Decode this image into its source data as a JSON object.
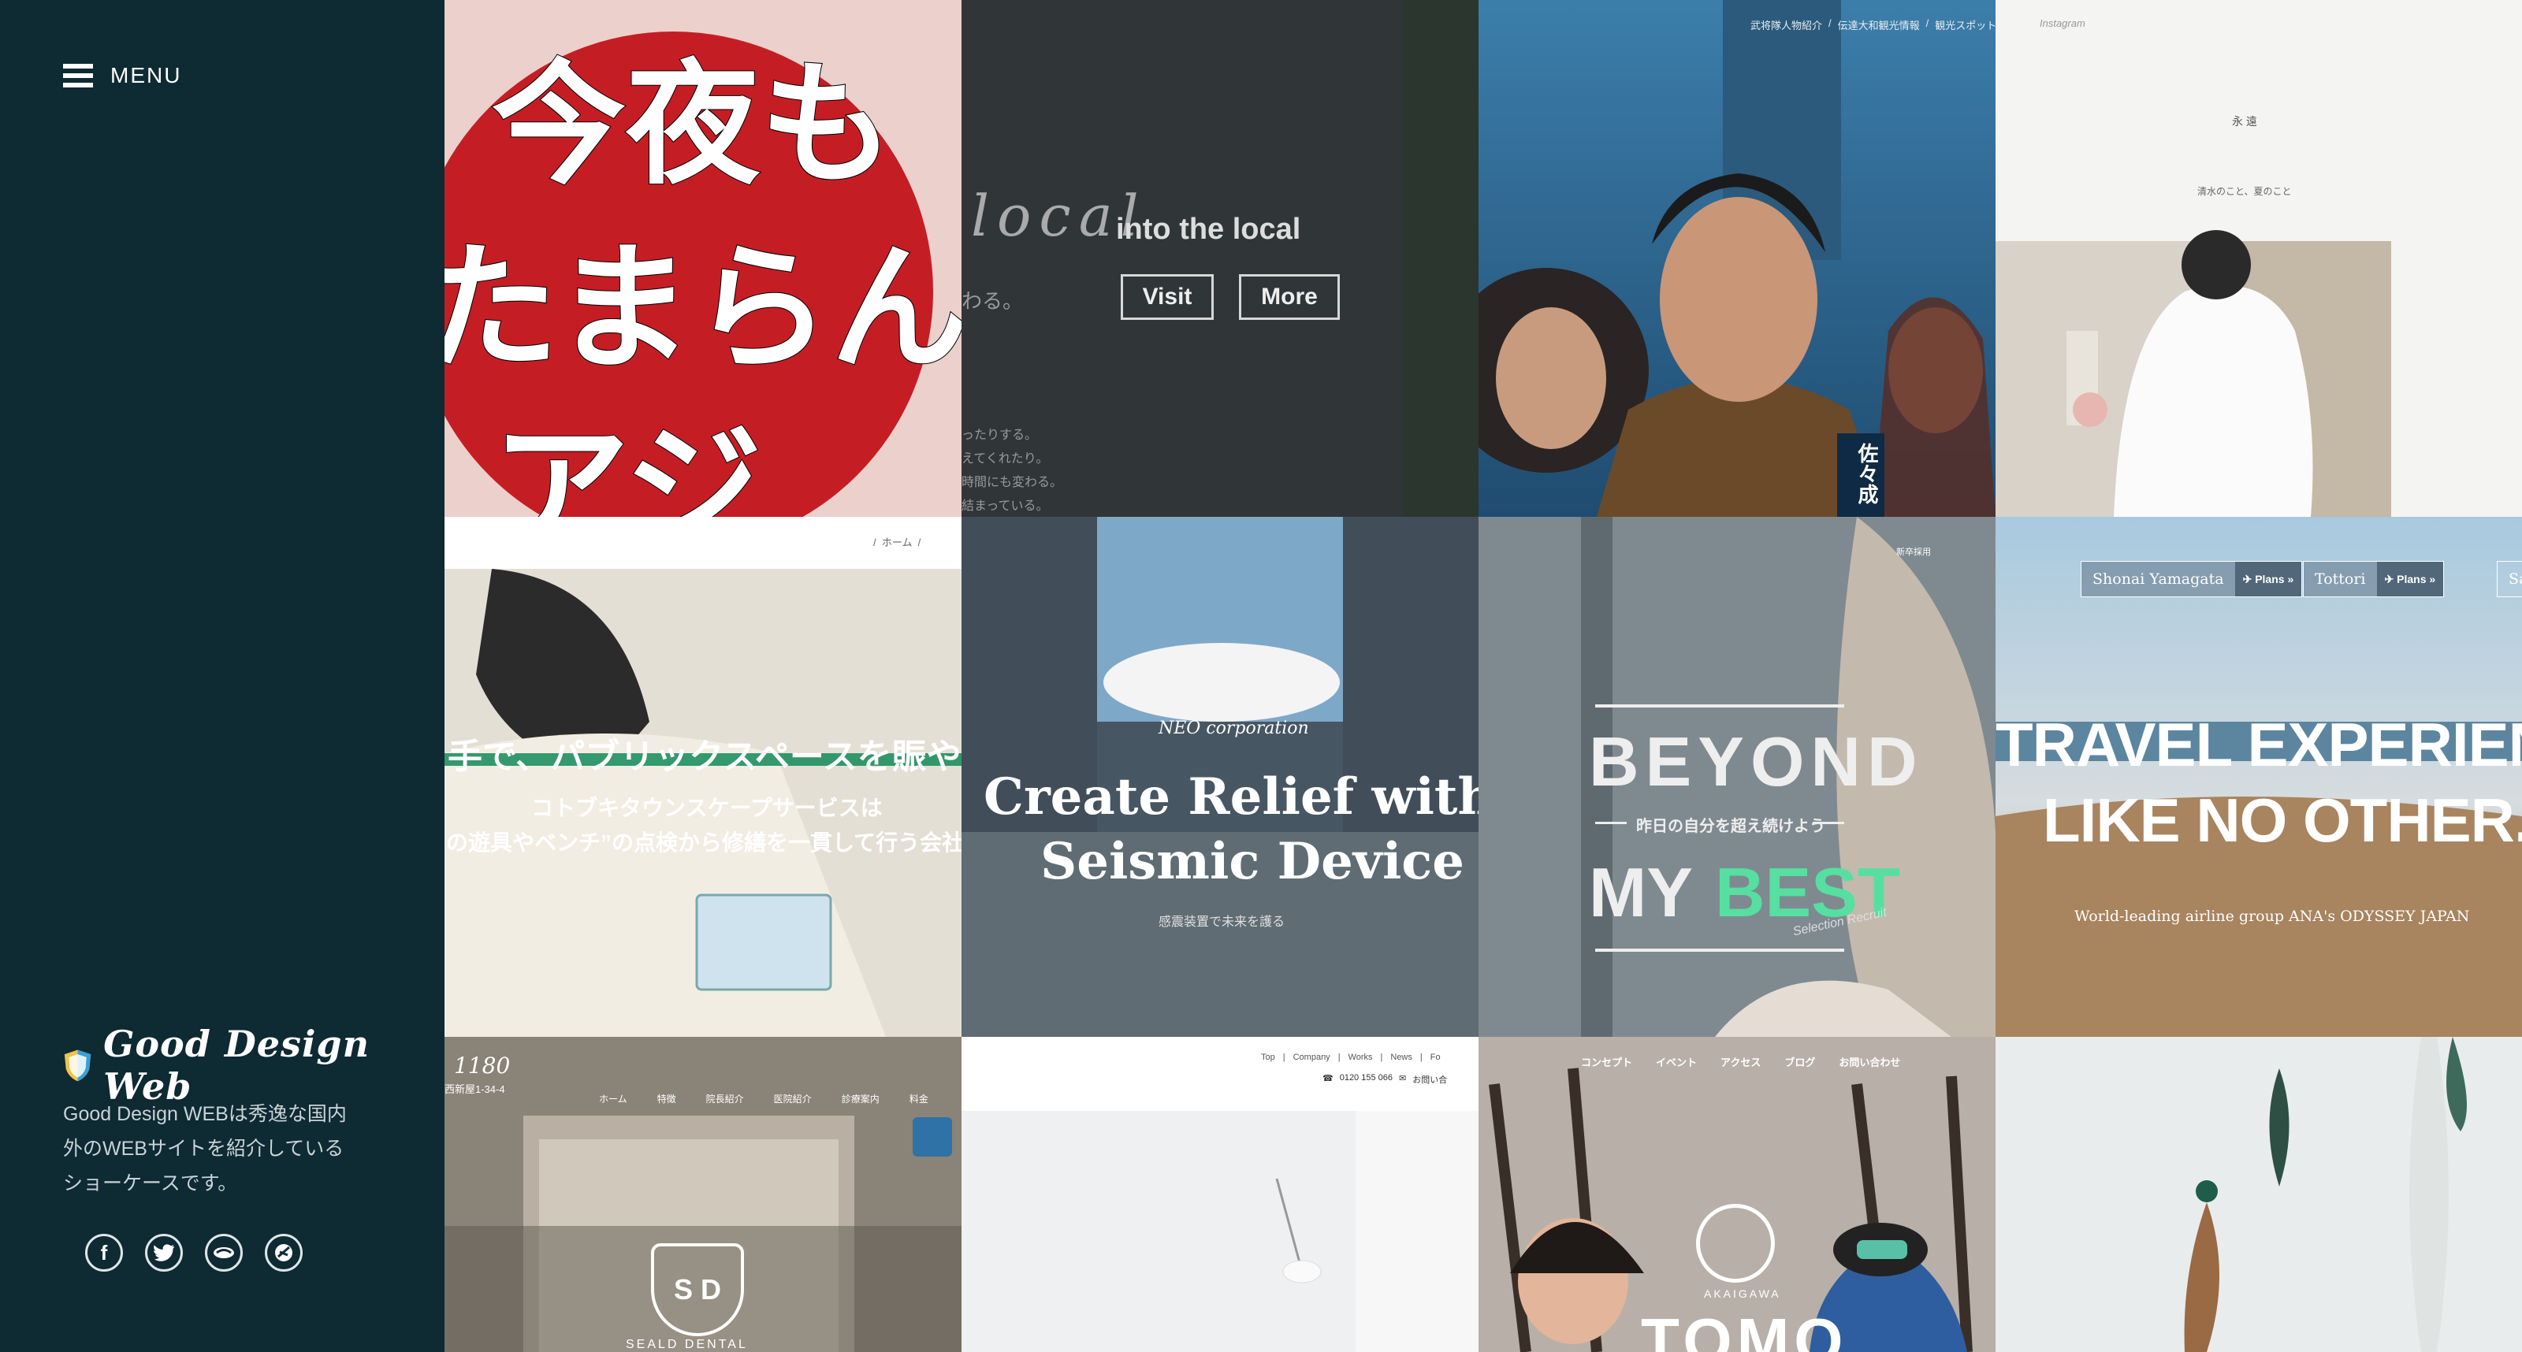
{
  "sidebar": {
    "menu_label": "MENU",
    "logo_text": "Good Design Web",
    "tagline": "Good Design WEBは秀逸な国内外のWEBサイトを紹介しているショーケースです。",
    "social": [
      {
        "icon": "facebook-icon",
        "glyph": "f"
      },
      {
        "icon": "twitter-icon",
        "glyph": "t"
      },
      {
        "icon": "feedly-icon",
        "glyph": "~"
      },
      {
        "icon": "dribbble-icon",
        "glyph": "z"
      }
    ]
  },
  "tiles": {
    "t1": {
      "lines": [
        "今夜も",
        "たまらん",
        "アジェ!"
      ]
    },
    "t2": {
      "script": "local",
      "title": "into the local",
      "sub": "わる。",
      "visit": "Visit",
      "more": "More",
      "body": [
        "ったりする。",
        "えてくれたり。",
        "時間にも変わる。",
        "結まっている。"
      ]
    },
    "t3": {
      "nav": [
        "武将隊人物紹介",
        "/",
        "伝達大和観光情報",
        "/",
        "観光スポット"
      ],
      "name": "佐々成"
    },
    "t4": {
      "nav": [
        "Instagram"
      ],
      "heading": "永 遠",
      "sub": "清水のこと、夏のこと"
    },
    "t5": {
      "crumb": "/  ホーム  /",
      "headline": "手で、パブリックスペースを賑やか",
      "sub1": "コトブキタウンスケープサービスは",
      "sub2": "の遊具やベンチ”の点検から修繕を一貫して行う会社"
    },
    "t6": {
      "brand": "NEO corporation",
      "title1": "Create Relief with a",
      "title2": "Seismic Device",
      "sub": "感震装置で未来を護る"
    },
    "t7": {
      "nav": "新卒採用",
      "title1": "BEYOND",
      "sub": "昨日の自分を超え続けよう",
      "title2a": "MY",
      "title2b": "BEST",
      "sign": "Selection Recruit"
    },
    "t8": {
      "tabs": [
        {
          "label": "Shonai Yamagata",
          "plans": "Plans"
        },
        {
          "label": "Tottori",
          "plans": "Plans"
        },
        {
          "label": "Sa"
        }
      ],
      "title1": "TRAVEL EXPERIENC",
      "title2": "LIKE NO OTHER.",
      "sub": "World-leading airline group ANA's ODYSSEY JAPAN"
    },
    "t9": {
      "num": "1180",
      "addr": "西新屋1-34-4",
      "nav": [
        "ホーム",
        "特徴",
        "院長紹介",
        "医院紹介",
        "診療案内",
        "料金"
      ],
      "brand": "SEALD DENTAL"
    },
    "t10": {
      "nav": [
        "Top",
        "Company",
        "Works",
        "News",
        "Fo"
      ],
      "phone": "0120 155 066",
      "mail": "お問い合"
    },
    "t11": {
      "nav": [
        "コンセプト",
        "イベント",
        "アクセス",
        "ブログ",
        "お問い合わせ"
      ],
      "brand_sub": "AKAIGAWA",
      "brand": "TOMO"
    },
    "t12": {}
  }
}
